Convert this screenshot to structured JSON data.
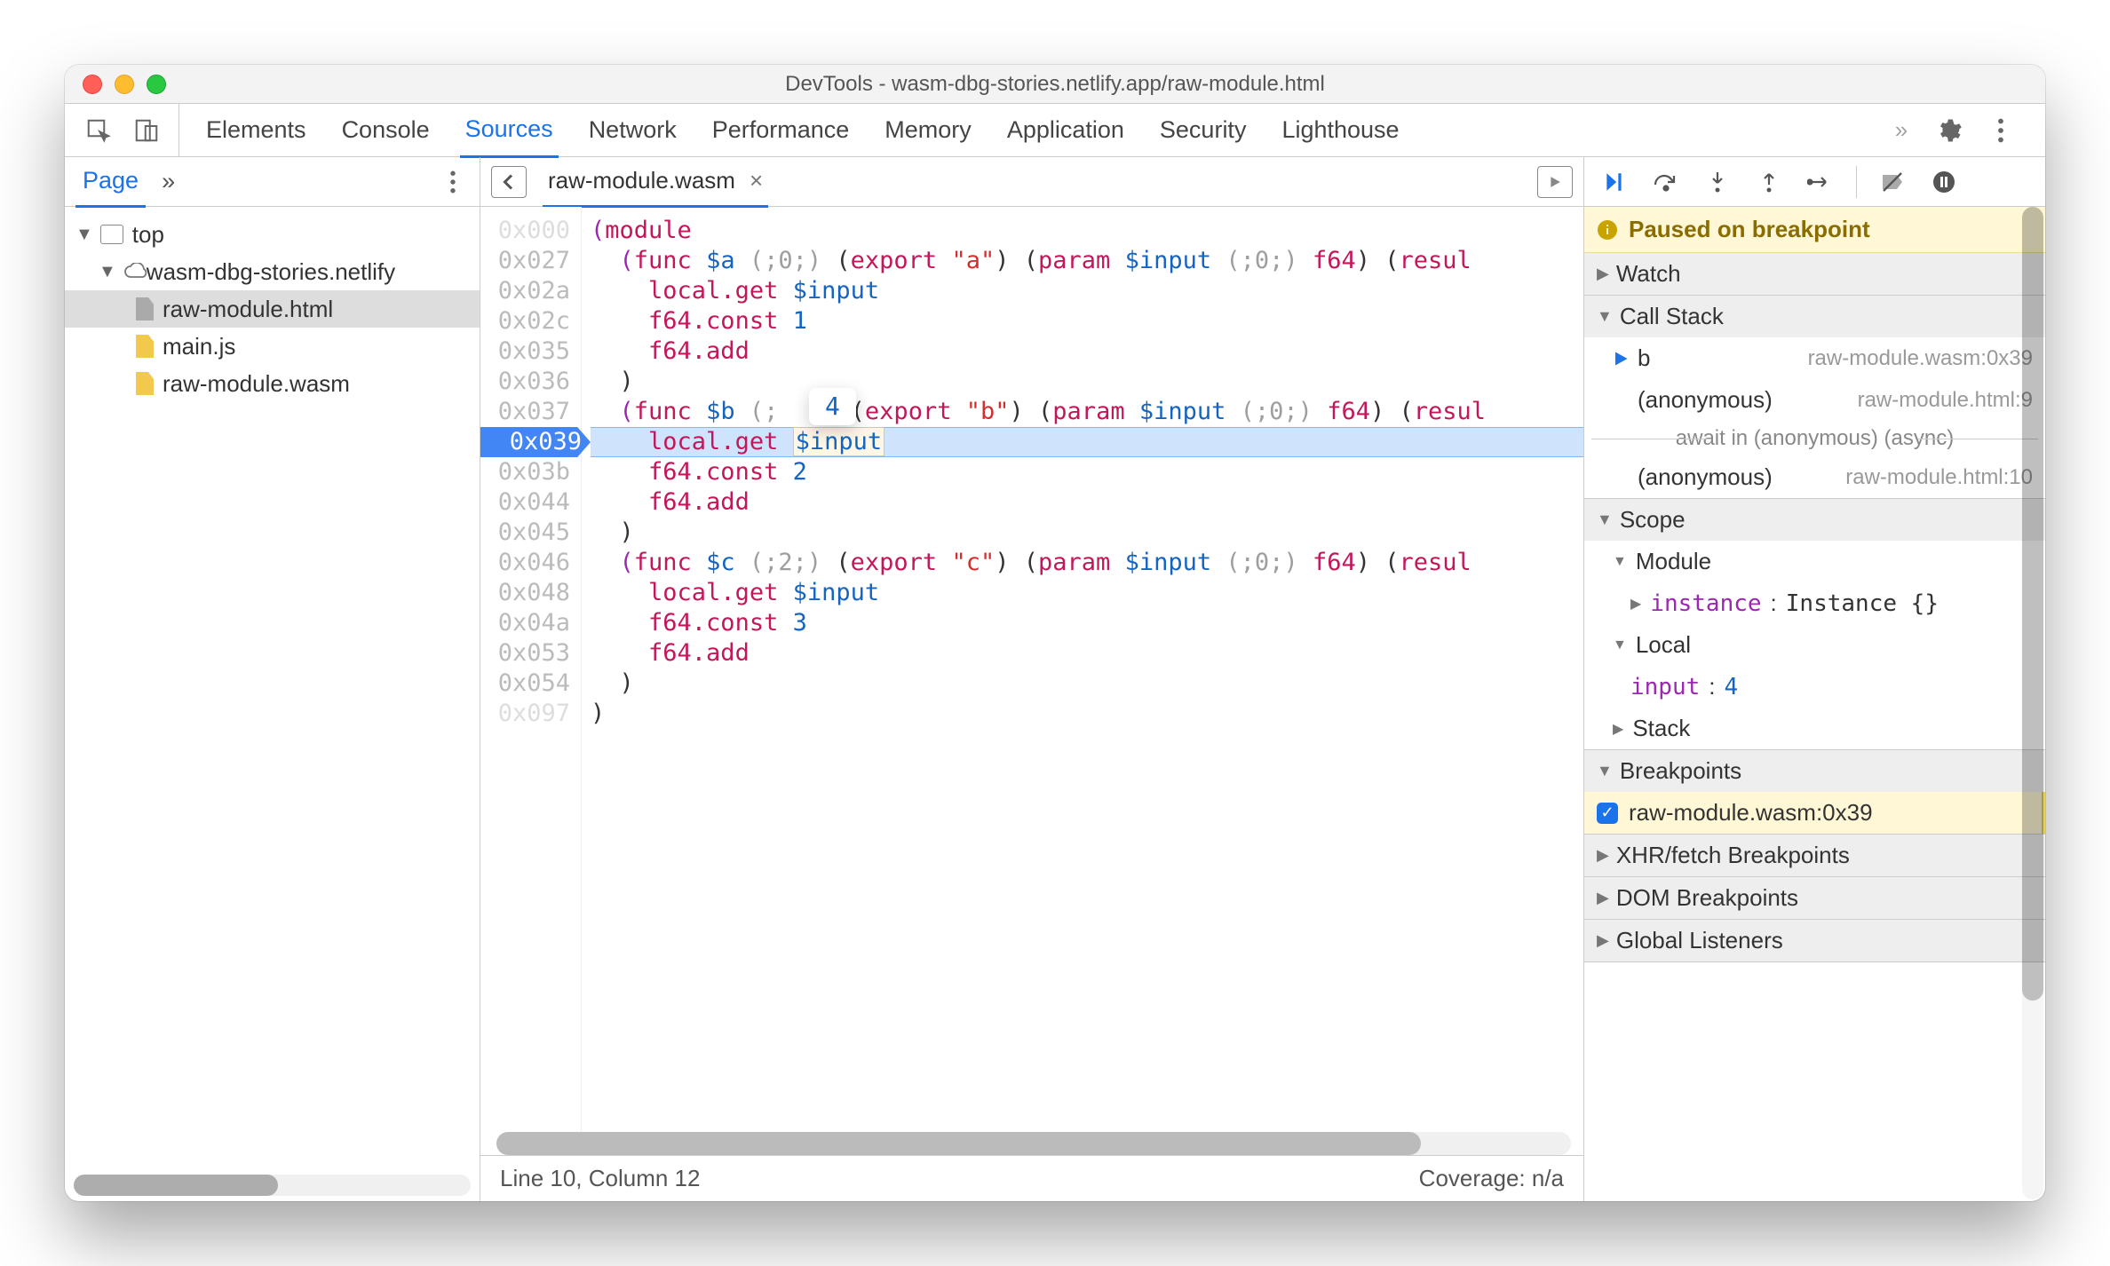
{
  "window": {
    "title": "DevTools - wasm-dbg-stories.netlify.app/raw-module.html"
  },
  "tabs": {
    "panels": [
      "Elements",
      "Console",
      "Sources",
      "Network",
      "Performance",
      "Memory",
      "Application",
      "Security",
      "Lighthouse"
    ],
    "active": "Sources"
  },
  "navigator": {
    "header_tab": "Page",
    "tree": {
      "top": "top",
      "origin": "wasm-dbg-stories.netlify",
      "files": [
        {
          "name": "raw-module.html",
          "type": "doc",
          "selected": true
        },
        {
          "name": "main.js",
          "type": "js",
          "selected": false
        },
        {
          "name": "raw-module.wasm",
          "type": "js",
          "selected": false
        }
      ]
    }
  },
  "editor": {
    "tab": {
      "name": "raw-module.wasm",
      "close": "×"
    },
    "tooltip_value": "4",
    "addresses": [
      "0x000",
      "0x027",
      "0x02a",
      "0x02c",
      "0x035",
      "0x036",
      "0x037",
      "0x039",
      "0x03b",
      "0x044",
      "0x045",
      "0x046",
      "0x048",
      "0x04a",
      "0x053",
      "0x054",
      "0x097"
    ],
    "dim_addresses": [
      0,
      16
    ],
    "highlight_addr_index": 7,
    "highlight_addr": "0x039",
    "code_lines": [
      [
        {
          "c": "kw",
          "t": "("
        },
        {
          "c": "op",
          "t": "module"
        }
      ],
      [
        {
          "c": "",
          "t": "  "
        },
        {
          "c": "kw",
          "t": "("
        },
        {
          "c": "op",
          "t": "func"
        },
        {
          "c": "",
          "t": " "
        },
        {
          "c": "fn",
          "t": "$a"
        },
        {
          "c": "",
          "t": " "
        },
        {
          "c": "cmt",
          "t": "(;0;)"
        },
        {
          "c": "",
          "t": " ("
        },
        {
          "c": "op",
          "t": "export"
        },
        {
          "c": "",
          "t": " "
        },
        {
          "c": "str",
          "t": "\"a\""
        },
        {
          "c": "",
          "t": ") ("
        },
        {
          "c": "op",
          "t": "param"
        },
        {
          "c": "",
          "t": " "
        },
        {
          "c": "var",
          "t": "$input"
        },
        {
          "c": "",
          "t": " "
        },
        {
          "c": "cmt",
          "t": "(;0;)"
        },
        {
          "c": "",
          "t": " "
        },
        {
          "c": "typ",
          "t": "f64"
        },
        {
          "c": "",
          "t": ") ("
        },
        {
          "c": "op",
          "t": "resul"
        }
      ],
      [
        {
          "c": "",
          "t": "    "
        },
        {
          "c": "ins",
          "t": "local.get"
        },
        {
          "c": "",
          "t": " "
        },
        {
          "c": "var",
          "t": "$input"
        }
      ],
      [
        {
          "c": "",
          "t": "    "
        },
        {
          "c": "ins",
          "t": "f64.const"
        },
        {
          "c": "",
          "t": " "
        },
        {
          "c": "num",
          "t": "1"
        }
      ],
      [
        {
          "c": "",
          "t": "    "
        },
        {
          "c": "ins",
          "t": "f64.add"
        }
      ],
      [
        {
          "c": "",
          "t": "  )"
        }
      ],
      [
        {
          "c": "",
          "t": "  "
        },
        {
          "c": "kw",
          "t": "("
        },
        {
          "c": "op",
          "t": "func"
        },
        {
          "c": "",
          "t": " "
        },
        {
          "c": "fn",
          "t": "$b"
        },
        {
          "c": "",
          "t": " "
        },
        {
          "c": "cmt",
          "t": "(;  ;)"
        },
        {
          "c": "",
          "t": " ("
        },
        {
          "c": "op",
          "t": "export"
        },
        {
          "c": "",
          "t": " "
        },
        {
          "c": "str",
          "t": "\"b\""
        },
        {
          "c": "",
          "t": ") ("
        },
        {
          "c": "op",
          "t": "param"
        },
        {
          "c": "",
          "t": " "
        },
        {
          "c": "var",
          "t": "$input"
        },
        {
          "c": "",
          "t": " "
        },
        {
          "c": "cmt",
          "t": "(;0;)"
        },
        {
          "c": "",
          "t": " "
        },
        {
          "c": "typ",
          "t": "f64"
        },
        {
          "c": "",
          "t": ") ("
        },
        {
          "c": "op",
          "t": "resul"
        }
      ],
      [
        {
          "c": "",
          "t": "    "
        },
        {
          "c": "ins",
          "t": "local.get"
        },
        {
          "c": "",
          "t": " "
        },
        {
          "c": "var hl-var-box",
          "t": "$input"
        }
      ],
      [
        {
          "c": "",
          "t": "    "
        },
        {
          "c": "ins",
          "t": "f64.const"
        },
        {
          "c": "",
          "t": " "
        },
        {
          "c": "num",
          "t": "2"
        }
      ],
      [
        {
          "c": "",
          "t": "    "
        },
        {
          "c": "ins",
          "t": "f64.add"
        }
      ],
      [
        {
          "c": "",
          "t": "  )"
        }
      ],
      [
        {
          "c": "",
          "t": "  "
        },
        {
          "c": "kw",
          "t": "("
        },
        {
          "c": "op",
          "t": "func"
        },
        {
          "c": "",
          "t": " "
        },
        {
          "c": "fn",
          "t": "$c"
        },
        {
          "c": "",
          "t": " "
        },
        {
          "c": "cmt",
          "t": "(;2;)"
        },
        {
          "c": "",
          "t": " ("
        },
        {
          "c": "op",
          "t": "export"
        },
        {
          "c": "",
          "t": " "
        },
        {
          "c": "str",
          "t": "\"c\""
        },
        {
          "c": "",
          "t": ") ("
        },
        {
          "c": "op",
          "t": "param"
        },
        {
          "c": "",
          "t": " "
        },
        {
          "c": "var",
          "t": "$input"
        },
        {
          "c": "",
          "t": " "
        },
        {
          "c": "cmt",
          "t": "(;0;)"
        },
        {
          "c": "",
          "t": " "
        },
        {
          "c": "typ",
          "t": "f64"
        },
        {
          "c": "",
          "t": ") ("
        },
        {
          "c": "op",
          "t": "resul"
        }
      ],
      [
        {
          "c": "",
          "t": "    "
        },
        {
          "c": "ins",
          "t": "local.get"
        },
        {
          "c": "",
          "t": " "
        },
        {
          "c": "var",
          "t": "$input"
        }
      ],
      [
        {
          "c": "",
          "t": "    "
        },
        {
          "c": "ins",
          "t": "f64.const"
        },
        {
          "c": "",
          "t": " "
        },
        {
          "c": "num",
          "t": "3"
        }
      ],
      [
        {
          "c": "",
          "t": "    "
        },
        {
          "c": "ins",
          "t": "f64.add"
        }
      ],
      [
        {
          "c": "",
          "t": "  )"
        }
      ],
      [
        {
          "c": "",
          "t": ")"
        }
      ]
    ],
    "status": {
      "left": "Line 10, Column 12",
      "right": "Coverage: n/a"
    }
  },
  "debugger": {
    "banner": "Paused on breakpoint",
    "sections": {
      "watch": "Watch",
      "callstack": "Call Stack",
      "scope": "Scope",
      "breakpoints": "Breakpoints",
      "xhr": "XHR/fetch Breakpoints",
      "dom": "DOM Breakpoints",
      "global": "Global Listeners"
    },
    "callstack": [
      {
        "fn": "b",
        "loc": "raw-module.wasm:0x39",
        "current": true
      },
      {
        "fn": "(anonymous)",
        "loc": "raw-module.html:9",
        "current": false
      }
    ],
    "async_label": "await in (anonymous) (async)",
    "callstack_after": [
      {
        "fn": "(anonymous)",
        "loc": "raw-module.html:10",
        "current": false
      }
    ],
    "scope": {
      "module": {
        "label": "Module",
        "item_key": "instance",
        "item_val": "Instance {}"
      },
      "local": {
        "label": "Local",
        "item_key": "input",
        "item_val": "4"
      },
      "stack": {
        "label": "Stack"
      }
    },
    "breakpoints": [
      {
        "checked": true,
        "label": "raw-module.wasm:0x39"
      }
    ]
  }
}
